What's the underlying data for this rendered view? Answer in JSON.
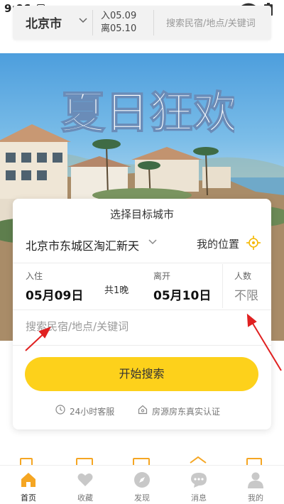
{
  "status_bar": {
    "time": "9:06",
    "notification_badge": "A"
  },
  "top_search": {
    "city": "北京市",
    "checkin": "入05.09",
    "checkout": "离05.10",
    "placeholder": "搜索民宿/地点/关键词"
  },
  "banner": {
    "title": "夏日狂欢"
  },
  "card": {
    "title": "选择目标城市",
    "location": "北京市东城区淘汇新天",
    "my_location": "我的位置",
    "checkin_label": "入住",
    "checkin_date": "05月09日",
    "nights": "共1晚",
    "checkout_label": "离开",
    "checkout_date": "05月10日",
    "guests_label": "人数",
    "guests_value": "不限",
    "search_placeholder": "搜索民宿/地点/关键词",
    "start_button": "开始搜索",
    "features": [
      "24小时客服",
      "房源房东真实认证"
    ]
  },
  "tabs": [
    {
      "label": "首页",
      "icon": "home-icon",
      "active": true
    },
    {
      "label": "收藏",
      "icon": "heart-icon",
      "active": false
    },
    {
      "label": "发现",
      "icon": "compass-icon",
      "active": false
    },
    {
      "label": "消息",
      "icon": "chat-icon",
      "active": false
    },
    {
      "label": "我的",
      "icon": "person-icon",
      "active": false
    }
  ],
  "colors": {
    "accent": "#fdd11b",
    "active_tab": "#f5a623",
    "inactive_tab": "#c8c8c8",
    "annotation": "#e02020"
  }
}
